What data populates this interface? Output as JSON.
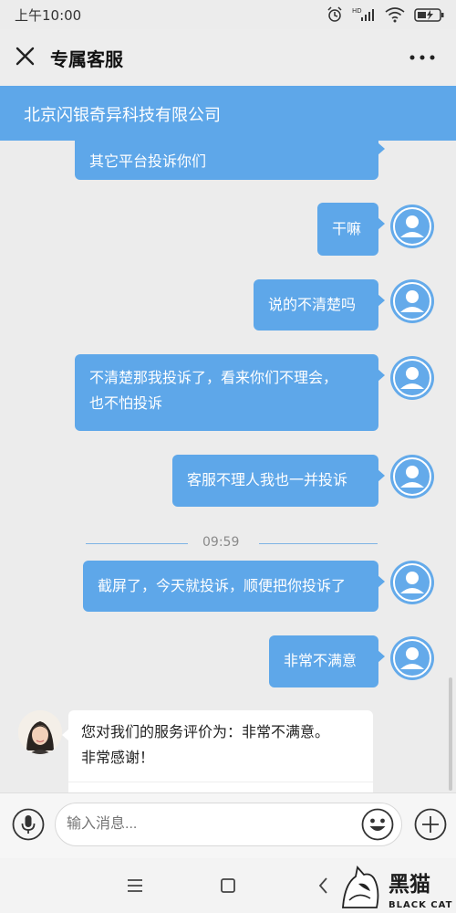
{
  "status_bar": {
    "time": "上午10:00",
    "hd_label": "HD"
  },
  "header": {
    "title": "专属客服"
  },
  "company": {
    "name": "北京闪银奇异科技有限公司"
  },
  "messages": [
    {
      "text_lines": [
        "其它平台投诉你们"
      ],
      "side": "right",
      "partial": true
    },
    {
      "text_lines": [
        "干嘛"
      ],
      "side": "right"
    },
    {
      "text_lines": [
        "说的不清楚吗"
      ],
      "side": "right"
    },
    {
      "text_lines": [
        "不清楚那我投诉了，看来你们不理会，",
        "也不怕投诉"
      ],
      "side": "right"
    },
    {
      "text_lines": [
        "客服不理人我也一并投诉"
      ],
      "side": "right"
    },
    {
      "text_lines": [
        "截屏了，今天就投诉，顺便把你投诉了"
      ],
      "side": "right"
    },
    {
      "text_lines": [
        "非常不满意"
      ],
      "side": "right"
    }
  ],
  "time_divider": "09:59",
  "agent_message": {
    "line1": "您对我们的服务评价为：非常不满意。",
    "line2": "非常感谢！"
  },
  "input": {
    "placeholder": "输入消息..."
  },
  "watermark": {
    "cn": "黑猫",
    "en": "BLACK CAT"
  },
  "colors": {
    "accent": "#5ea7e9",
    "background": "#ececec"
  },
  "icons": [
    "close-icon",
    "more-icon",
    "user-avatar-icon",
    "mic-icon",
    "emoji-icon",
    "plus-icon",
    "menu-icon",
    "home-icon",
    "back-icon",
    "alarm-icon",
    "signal-icon",
    "wifi-icon",
    "battery-icon"
  ]
}
